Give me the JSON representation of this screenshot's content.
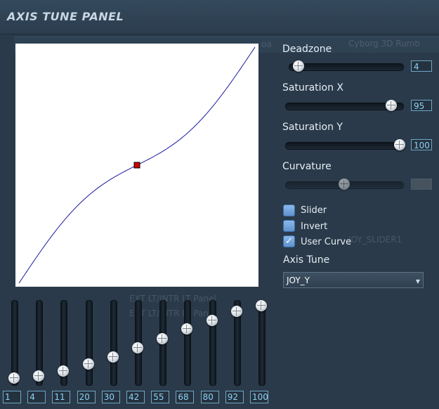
{
  "panel": {
    "title": "AXIS TUNE PANEL"
  },
  "background_text": {
    "tab_fragment": "oa",
    "tab_right": "Cyborg 3D Rumb",
    "line_1": "JOY_SLIDER1",
    "line_2": "EXT LT/INTR LT Panel",
    "line_3": "EXT LT/INTR LT Panel"
  },
  "curve": {
    "point_count": 11,
    "control_point": [
      0.5,
      0.5
    ],
    "line_color": "#1a1aa0",
    "point_color": "#cc0000"
  },
  "controls": {
    "deadzone": {
      "label": "Deadzone",
      "value": "4",
      "fraction": 0.04
    },
    "saturation_x": {
      "label": "Saturation X",
      "value": "95",
      "fraction": 0.95
    },
    "saturation_y": {
      "label": "Saturation Y",
      "value": "100",
      "fraction": 1.0
    },
    "curvature": {
      "label": "Curvature",
      "value": "",
      "fraction": 0.5,
      "disabled": true
    }
  },
  "checkboxes": [
    {
      "label": "Slider",
      "checked": false
    },
    {
      "label": "Invert",
      "checked": false
    },
    {
      "label": "User Curve",
      "checked": true
    }
  ],
  "axis_tune": {
    "label": "Axis Tune",
    "selected": "JOY_Y"
  },
  "vertical_sliders": [
    {
      "value": "1",
      "percent": 1
    },
    {
      "value": "4",
      "percent": 4
    },
    {
      "value": "11",
      "percent": 11
    },
    {
      "value": "20",
      "percent": 20
    },
    {
      "value": "30",
      "percent": 30
    },
    {
      "value": "42",
      "percent": 42
    },
    {
      "value": "55",
      "percent": 55
    },
    {
      "value": "68",
      "percent": 68
    },
    {
      "value": "80",
      "percent": 80
    },
    {
      "value": "92",
      "percent": 92
    },
    {
      "value": "100",
      "percent": 100
    }
  ]
}
